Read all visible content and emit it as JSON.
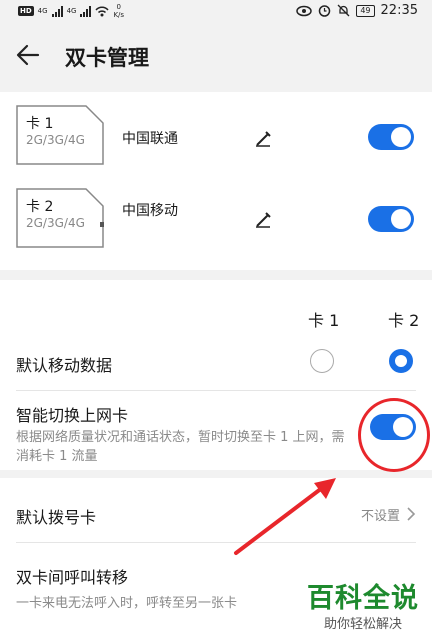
{
  "status": {
    "net1": "4G",
    "net2": "4G",
    "speed_val": "0",
    "speed_unit": "K/s",
    "battery": "49",
    "time": "22:35",
    "hd": "HD"
  },
  "header": {
    "title": "双卡管理"
  },
  "sims": [
    {
      "name": "卡 1",
      "types": "2G/3G/4G",
      "carrier": "中国联通",
      "enabled": true
    },
    {
      "name": "卡 2",
      "types": "2G/3G/4G",
      "carrier": "中国移动",
      "enabled": true
    }
  ],
  "columns": {
    "card1": "卡 1",
    "card2": "卡 2"
  },
  "mobile_data": {
    "label": "默认移动数据",
    "selected": "卡 2"
  },
  "smart_switch": {
    "label": "智能切换上网卡",
    "desc": "根据网络质量状况和通话状态，暂时切换至卡 1 上网，需消耗卡 1 流量",
    "enabled": true
  },
  "default_call": {
    "label": "默认拨号卡",
    "value": "不设置"
  },
  "forwarding": {
    "label": "双卡间呼叫转移",
    "desc": "一卡来电无法呼入时，呼转至另一张卡"
  },
  "watermark": {
    "title": "百科全说",
    "subtitle": "助你轻松解决"
  },
  "colors": {
    "accent": "#1a70e6",
    "annotation": "#e8262b",
    "watermark": "#1e8a2e"
  }
}
